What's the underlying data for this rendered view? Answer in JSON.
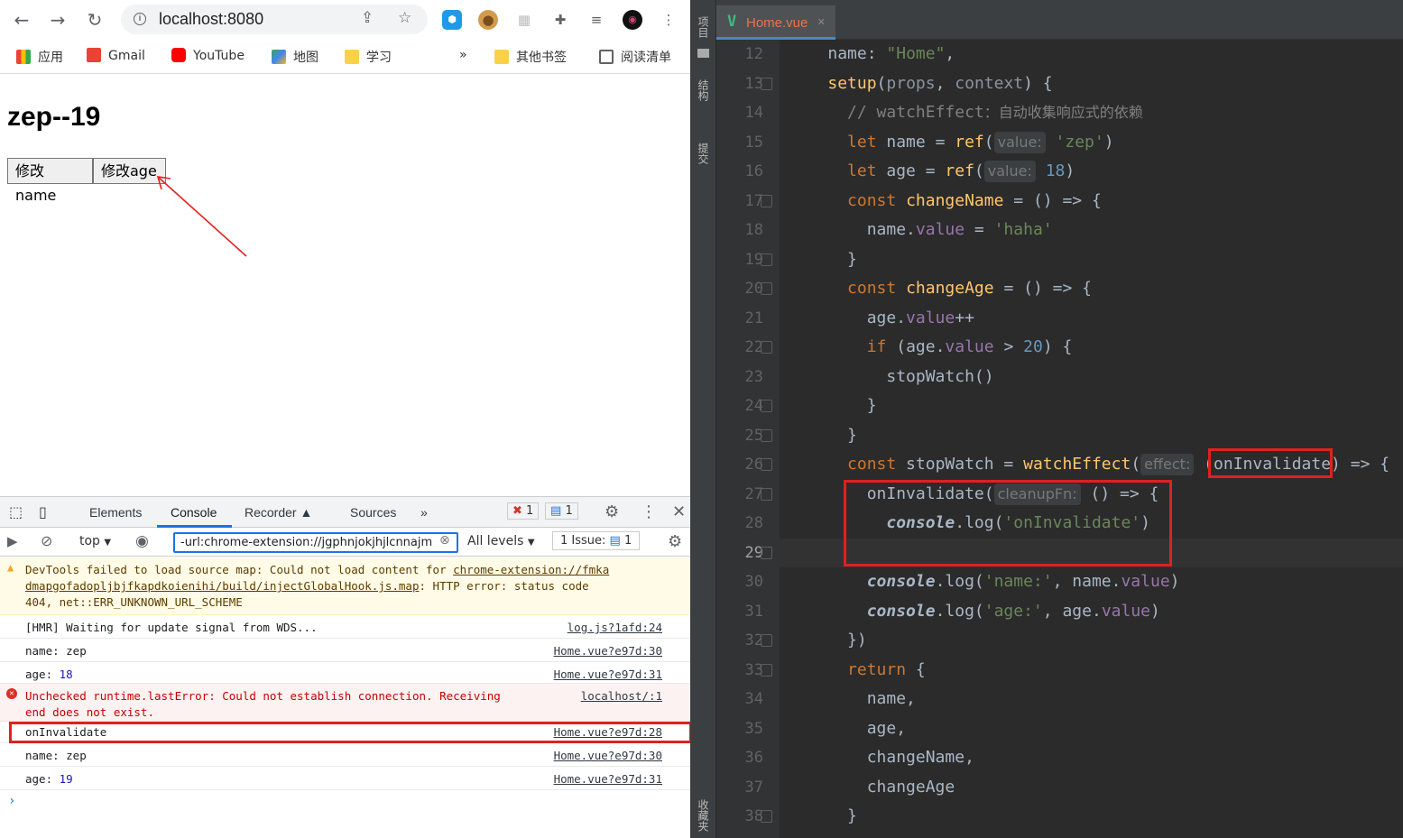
{
  "browser": {
    "address": "localhost:8080",
    "bookmarks": [
      "应用",
      "Gmail",
      "YouTube",
      "地图",
      "学习",
      "»",
      "其他书签",
      "阅读清单"
    ]
  },
  "page": {
    "heading": "zep--19",
    "buttons": [
      "修改name",
      "修改age"
    ]
  },
  "devtools": {
    "tabs": [
      "Elements",
      "Console",
      "Recorder",
      "Sources",
      "»"
    ],
    "error_count": "1",
    "message_count": "1",
    "context": "top",
    "filter_value": "-url:chrome-extension://jgphnjokjhjlcnnajm",
    "levels": "All levels",
    "issues": "1 Issue:",
    "issues_count": "1",
    "console": [
      {
        "type": "warn",
        "line1": "DevTools failed to load source map: Could not load content for ",
        "link1": "chrome-extension://fmka",
        "line2": "dmapgofadopljbjfkapdkoienihi/build/injectGlobalHook.js.map",
        "line2b": ": HTTP error: status code",
        "line3": "404, net::ERR_UNKNOWN_URL_SCHEME"
      },
      {
        "type": "log",
        "text": "[HMR] Waiting for update signal from WDS...",
        "src": "log.js?1afd:24"
      },
      {
        "type": "log",
        "text": "name: zep",
        "src": "Home.vue?e97d:30"
      },
      {
        "type": "log",
        "text": "age: ",
        "num": "18",
        "src": "Home.vue?e97d:31"
      },
      {
        "type": "error",
        "line1": "Unchecked runtime.lastError: Could not establish connection. Receiving",
        "line2": "end does not exist.",
        "src": "localhost/:1"
      },
      {
        "type": "log",
        "text": "onInvalidate",
        "src": "Home.vue?e97d:28"
      },
      {
        "type": "log",
        "text": "name: zep",
        "src": "Home.vue?e97d:30"
      },
      {
        "type": "log",
        "text": "age: ",
        "num": "19",
        "src": "Home.vue?e97d:31"
      }
    ],
    "prompt": "›"
  },
  "ide": {
    "side_labels": [
      "项目",
      "结构",
      "提交",
      "收藏夹"
    ],
    "tab_name": "Home.vue",
    "line_numbers": [
      "12",
      "13",
      "14",
      "15",
      "16",
      "17",
      "18",
      "19",
      "20",
      "21",
      "22",
      "23",
      "24",
      "25",
      "26",
      "27",
      "28",
      "29",
      "30",
      "31",
      "32",
      "33",
      "34",
      "35",
      "36",
      "37",
      "38"
    ],
    "current_line": "29"
  },
  "colors": {
    "annotation_red": "#e0211e",
    "vue_green": "#41b883",
    "devtools_blue": "#1a73e8"
  }
}
